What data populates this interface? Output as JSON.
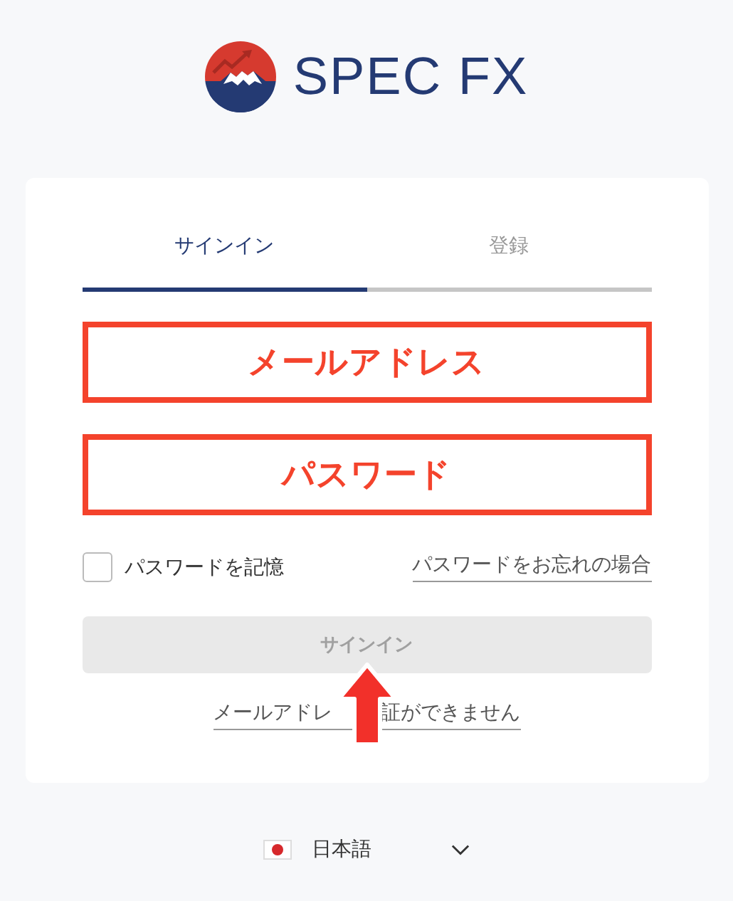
{
  "logo": {
    "text": "SPEC FX"
  },
  "tabs": [
    {
      "label": "サインイン",
      "selected": true
    },
    {
      "label": "登録",
      "selected": false
    }
  ],
  "annotations": [
    {
      "label": "メールアドレス"
    },
    {
      "label": "パスワード"
    }
  ],
  "remember": {
    "label": "パスワードを記憶",
    "checked": false
  },
  "forgot_link": "パスワードをお忘れの場合",
  "signin_button": {
    "label": "サインイン",
    "disabled": true
  },
  "verify_link": {
    "parts": [
      "メールアドレ",
      "証ができません"
    ]
  },
  "language": {
    "label": "日本語"
  }
}
